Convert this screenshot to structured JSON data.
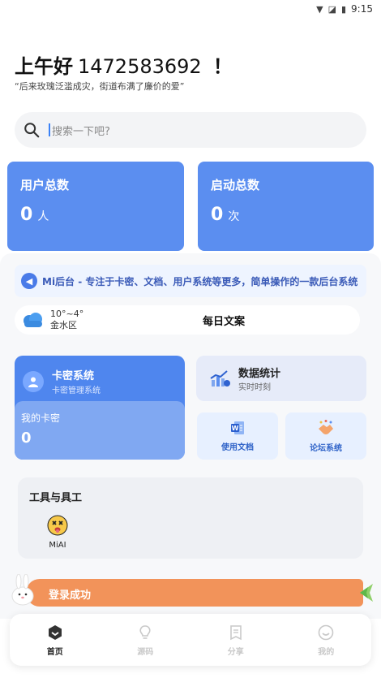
{
  "status_bar": {
    "time": "9:15"
  },
  "greeting": {
    "hello": "上午好",
    "user_id": "1472583692",
    "exclaim": "！"
  },
  "quote": "“后来玫瑰泛滥成灾，街道布满了廉价的爱”",
  "search": {
    "placeholder": "搜索一下吧?"
  },
  "stats": [
    {
      "title": "用户总数",
      "value": "0",
      "unit": "人"
    },
    {
      "title": "启动总数",
      "value": "0",
      "unit": "次"
    }
  ],
  "notice": "Mi后台 - 专注于卡密、文档、用户系统等更多，简单操作的一款后台系统",
  "weather": {
    "temp": "10°~4°",
    "location": "金水区",
    "daily": "每日文案"
  },
  "km_card": {
    "title": "卡密系统",
    "subtitle": "卡密管理系统",
    "my_label": "我的卡密",
    "my_value": "0"
  },
  "stats_card": {
    "title": "数据统计",
    "subtitle": "实时时刻"
  },
  "mini_cards": [
    {
      "label": "使用文档"
    },
    {
      "label": "论坛系统"
    }
  ],
  "tools": {
    "title": "工具与具工",
    "items": [
      {
        "label": "MiAI"
      }
    ]
  },
  "toast": "登录成功",
  "nav": [
    {
      "label": "首页",
      "active": true
    },
    {
      "label": "源码",
      "active": false
    },
    {
      "label": "分享",
      "active": false
    },
    {
      "label": "我的",
      "active": false
    }
  ],
  "colors": {
    "accent": "#5b8ef0",
    "toast": "#f2935a"
  }
}
